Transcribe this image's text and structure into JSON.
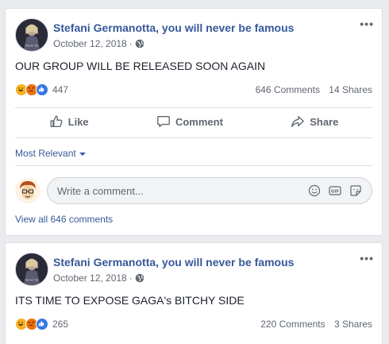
{
  "posts": [
    {
      "group_name": "Stefani Germanotta, you will never be famous",
      "date": "October 12, 2018",
      "date_separator": "·",
      "text": "OUR GROUP WILL BE RELEASED SOON AGAIN",
      "reaction_count": "447",
      "comments_count": "646 Comments",
      "shares_count": "14 Shares",
      "actions": {
        "like": "Like",
        "comment": "Comment",
        "share": "Share"
      },
      "sort_label": "Most Relevant",
      "comment_placeholder": "Write a comment...",
      "view_all": "View all 646 comments"
    },
    {
      "group_name": "Stefani Germanotta, you will never be famous",
      "date": "October 12, 2018",
      "date_separator": "·",
      "text": "ITS TIME TO EXPOSE GAGA's BITCHY SIDE",
      "reaction_count": "265",
      "comments_count": "220 Comments",
      "shares_count": "3 Shares"
    }
  ],
  "more_glyph": "•••",
  "icons": {
    "privacy": "globe-icon",
    "more": "more-options-icon",
    "reactions": [
      "haha-icon",
      "angry-icon",
      "like-reaction-icon"
    ],
    "like": "thumbs-up-icon",
    "comment": "comment-bubble-icon",
    "share": "share-arrow-icon",
    "emoji": "emoji-icon",
    "gif": "gif-icon",
    "sticker": "sticker-icon"
  },
  "colors": {
    "link": "#365899",
    "background": "#e9ebee",
    "haha": "#f7b125",
    "angry": "#e9710f",
    "like": "#3578e5"
  }
}
